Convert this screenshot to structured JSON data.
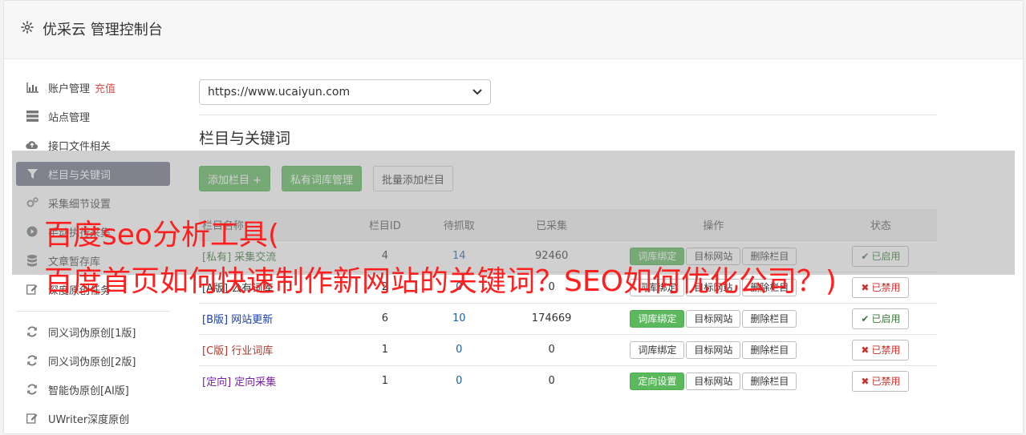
{
  "header": {
    "title": "优采云 管理控制台",
    "icon": "gear-icon"
  },
  "sidebar": {
    "items": [
      {
        "label": "账户管理",
        "extra": "充值",
        "icon": "bar-chart-icon"
      },
      {
        "label": "站点管理",
        "icon": "server-icon"
      },
      {
        "label": "接口文件相关",
        "icon": "cloud-upload-icon"
      },
      {
        "label": "栏目与关键词",
        "icon": "filter-icon",
        "active": true
      },
      {
        "label": "采集细节设置",
        "icon": "gears-icon"
      },
      {
        "label": "手动执行采集",
        "icon": "play-circle-icon"
      },
      {
        "label": "文章暂存库",
        "icon": "database-icon"
      },
      {
        "label": "深度原创任务",
        "icon": "edit-icon"
      }
    ],
    "items2": [
      {
        "label": "同义词伪原创[1版]",
        "icon": "refresh-icon"
      },
      {
        "label": "同义词伪原创[2版]",
        "icon": "refresh-icon"
      },
      {
        "label": "智能伪原创[AI版]",
        "icon": "refresh-icon"
      },
      {
        "label": "UWriter深度原创",
        "icon": "edit-icon"
      }
    ]
  },
  "site_select": {
    "value": "https://www.ucaiyun.com"
  },
  "section": {
    "title": "栏目与关键词"
  },
  "toolbar": {
    "add": "添加栏目 +",
    "private": "私有词库管理",
    "batch": "批量添加栏目"
  },
  "table": {
    "headers": [
      "栏目名称",
      "栏目ID",
      "待抓取",
      "已采集",
      "操作",
      "状态"
    ],
    "rows": [
      {
        "tag": "[私有]",
        "name": "采集交流",
        "id": "4",
        "pending": "14",
        "collected": "92460",
        "op1": "词库绑定",
        "op1_green": true,
        "op2": "目标网站",
        "op3": "删除栏目",
        "status": "已启用",
        "on": true
      },
      {
        "tag": "[A版]",
        "name": "公有词库",
        "id": "2",
        "pending": "0",
        "collected": "0",
        "op1": "词库绑定",
        "op1_green": false,
        "op2": "目标网站",
        "op3": "删除栏目",
        "status": "已禁用",
        "on": false
      },
      {
        "tag": "[B版]",
        "name": "网站更新",
        "id": "6",
        "pending": "10",
        "collected": "174669",
        "op1": "词库绑定",
        "op1_green": true,
        "op2": "目标网站",
        "op3": "删除栏目",
        "status": "已启用",
        "on": true
      },
      {
        "tag": "[C版]",
        "name": "行业词库",
        "id": "1",
        "pending": "0",
        "collected": "0",
        "op1": "词库绑定",
        "op1_green": false,
        "op2": "目标网站",
        "op3": "删除栏目",
        "status": "已禁用",
        "on": false
      },
      {
        "tag": "[定向]",
        "name": "定向采集",
        "id": "1",
        "pending": "0",
        "collected": "0",
        "op1": "定向设置",
        "op1_green": true,
        "op2": "目标网站",
        "op3": "删除栏目",
        "status": "已禁用",
        "on": false
      }
    ]
  },
  "overlay": {
    "line1": "百度seo分析工具(",
    "line2": "百度首页如何快速制作新网站的关键词？SEO如何优化公司？)"
  }
}
